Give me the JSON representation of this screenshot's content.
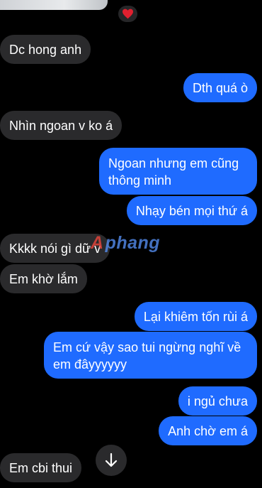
{
  "reaction": {
    "icon": "heart-icon",
    "color": "#e0202f"
  },
  "watermark": {
    "logo_letter": "A",
    "text": "phang"
  },
  "messages": [
    {
      "side": "in",
      "text": "Dc hong anh"
    },
    {
      "side": "out",
      "text": "Dth quá ò"
    },
    {
      "side": "in",
      "text": "Nhìn ngoan v ko á"
    },
    {
      "side": "out",
      "text": "Ngoan nhưng em cũng thông minh"
    },
    {
      "side": "out",
      "text": "Nhạy bén mọi thứ á"
    },
    {
      "side": "in",
      "text": "Kkkk nói gì dữ v"
    },
    {
      "side": "in",
      "text": "Em khờ lắm"
    },
    {
      "side": "out",
      "text": "Lại khiêm tốn rùi á"
    },
    {
      "side": "out",
      "text": "Em cứ vậy sao tui ngừng nghĩ về em đâyyyyyy"
    },
    {
      "side": "out",
      "text": "i ngủ chưa"
    },
    {
      "side": "out",
      "text": "Anh chờ em á"
    },
    {
      "side": "in",
      "text": "Em cbi thui"
    }
  ],
  "scroll_button": {
    "icon": "arrow-down-icon"
  },
  "colors": {
    "incoming": "#2a2a2c",
    "outgoing": "#1f6bff",
    "background": "#000000"
  }
}
